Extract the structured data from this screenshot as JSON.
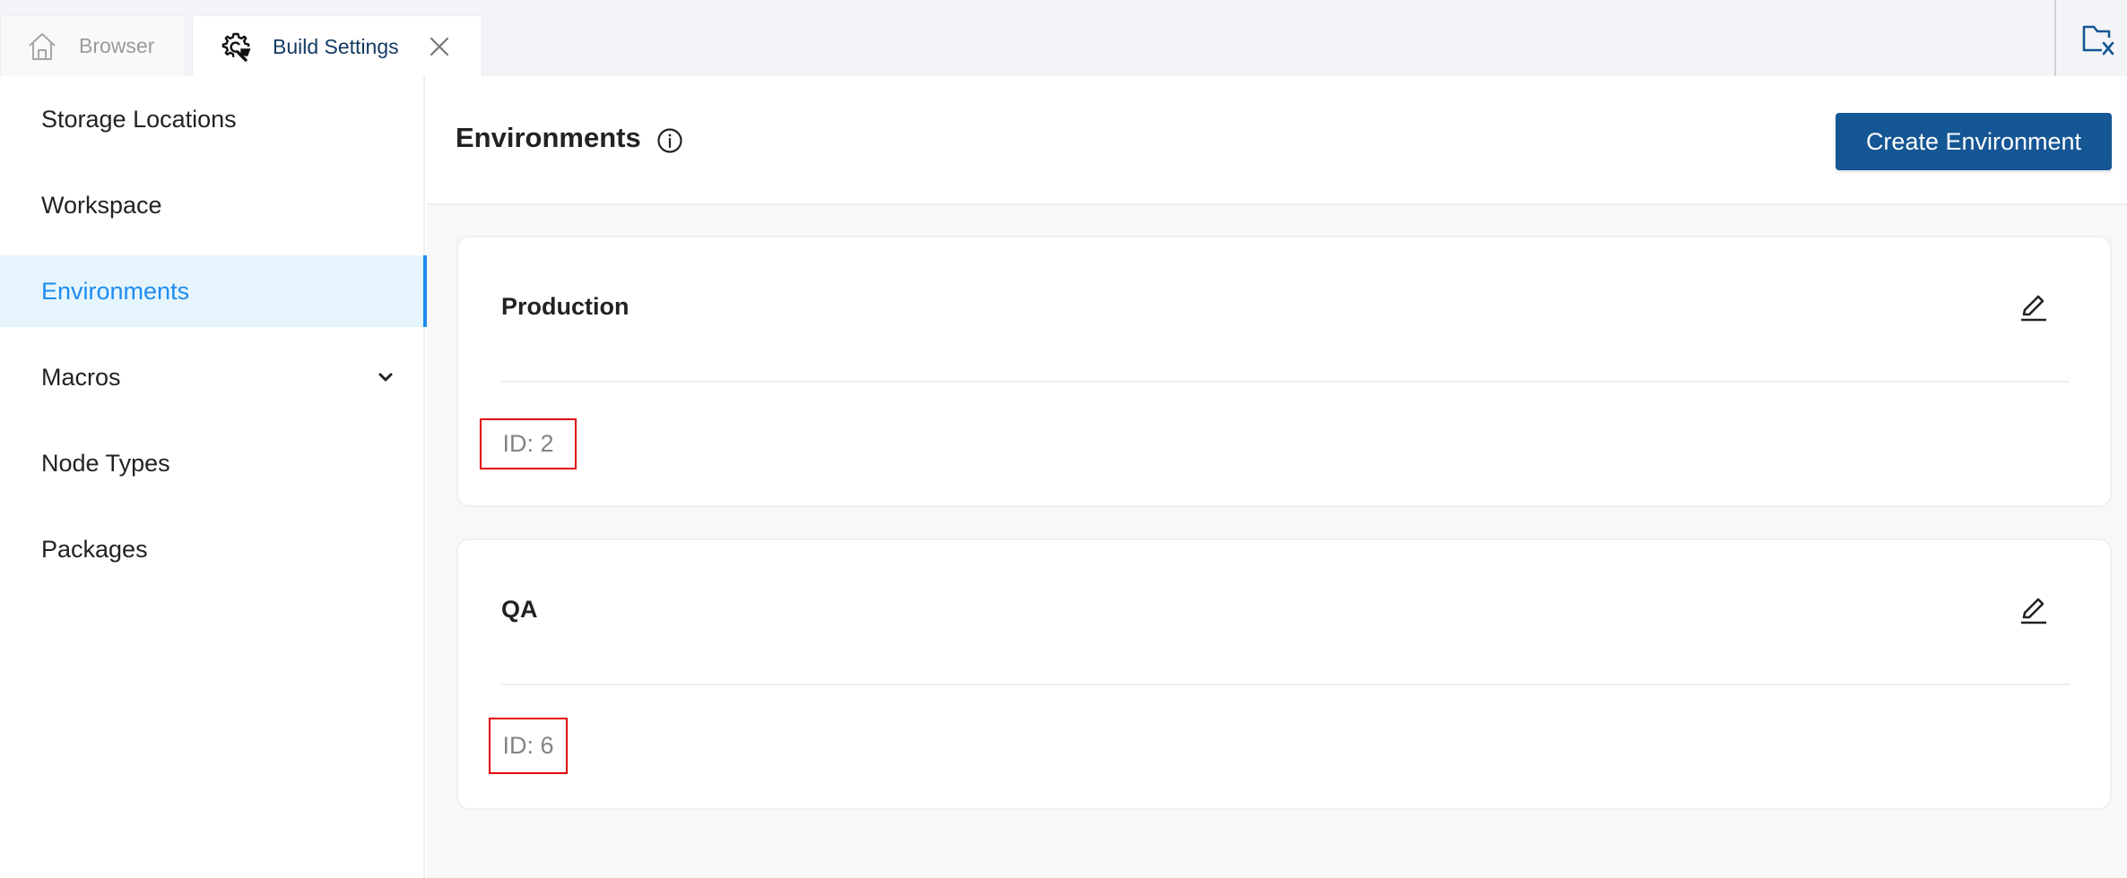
{
  "tabs": [
    {
      "label": "Browser",
      "icon": "home-icon",
      "active": false
    },
    {
      "label": "Build Settings",
      "icon": "gear-wrench-icon",
      "active": true,
      "closable": true
    }
  ],
  "toolbar_right": {
    "icon": "folder-close-icon"
  },
  "sidebar": {
    "items": [
      {
        "label": "Storage Locations",
        "active": false
      },
      {
        "label": "Workspace",
        "active": false
      },
      {
        "label": "Environments",
        "active": true
      },
      {
        "label": "Macros",
        "active": false,
        "expandable": true
      },
      {
        "label": "Node Types",
        "active": false
      },
      {
        "label": "Packages",
        "active": false
      }
    ]
  },
  "header": {
    "title": "Environments",
    "create_button": "Create Environment"
  },
  "environments": [
    {
      "name": "Production",
      "id_label": "ID: 2"
    },
    {
      "name": "QA",
      "id_label": "ID: 6"
    }
  ],
  "colors": {
    "accent": "#1e8cf0",
    "primary_button": "#155694",
    "active_tab_text": "#143b63",
    "highlight_box": "#e00000"
  }
}
